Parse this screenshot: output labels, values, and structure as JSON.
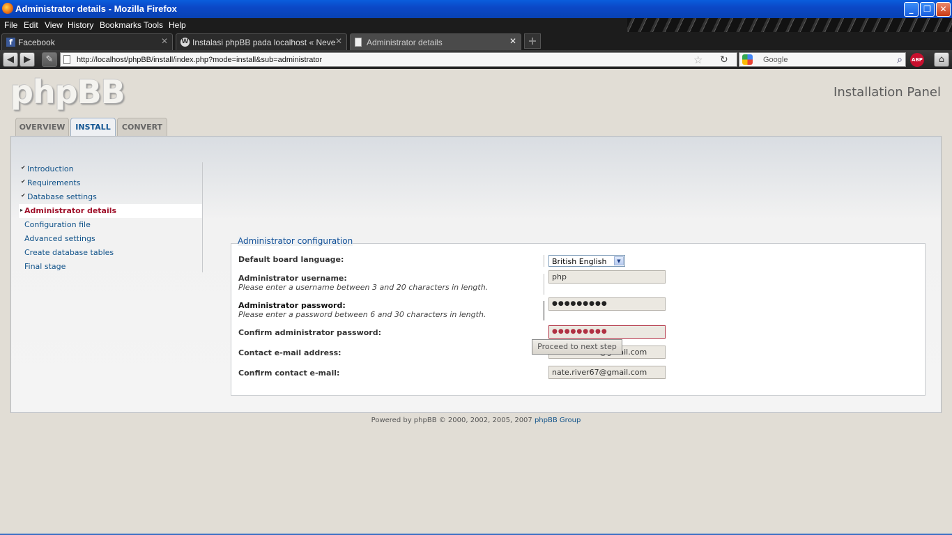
{
  "window": {
    "title": "Administrator details - Mozilla Firefox",
    "minimize": "_",
    "restore": "❐",
    "close": "✕"
  },
  "menu": [
    "File",
    "Edit",
    "View",
    "History",
    "Bookmarks",
    "Tools",
    "Help"
  ],
  "browser_tabs": [
    {
      "label": "Facebook",
      "icon": "facebook-icon"
    },
    {
      "label": "Instalasi phpBB pada localhost « Never E...",
      "icon": "wordpress-icon"
    },
    {
      "label": "Administrator details",
      "icon": "page-icon"
    }
  ],
  "new_tab": "+",
  "address": {
    "url": "http://localhost/phpBB/install/index.php?mode=install&sub=administrator"
  },
  "search": {
    "placeholder": "Google"
  },
  "abp": "ABP",
  "site": {
    "logo": "phpBB",
    "panel_title": "Installation Panel"
  },
  "page_tabs": [
    "OVERVIEW",
    "INSTALL",
    "CONVERT"
  ],
  "sidebar": {
    "items": [
      {
        "label": "Introduction",
        "state": "done"
      },
      {
        "label": "Requirements",
        "state": "done"
      },
      {
        "label": "Database settings",
        "state": "done"
      },
      {
        "label": "Administrator details",
        "state": "active"
      },
      {
        "label": "Configuration file",
        "state": "todo"
      },
      {
        "label": "Advanced settings",
        "state": "todo"
      },
      {
        "label": "Create database tables",
        "state": "todo"
      },
      {
        "label": "Final stage",
        "state": "todo"
      }
    ]
  },
  "form": {
    "legend": "Administrator configuration",
    "language_label": "Default board language:",
    "language_value": "British English",
    "username_label": "Administrator username:",
    "username_hint": "Please enter a username between 3 and 20 characters in length.",
    "username_value": "php",
    "password_label": "Administrator password:",
    "password_hint": "Please enter a password between 6 and 30 characters in length.",
    "password_value": "●●●●●●●●●",
    "confirm_password_label": "Confirm administrator password:",
    "confirm_password_value": "●●●●●●●●●",
    "email_label": "Contact e-mail address:",
    "email_value": "nate.river67@gmail.com",
    "confirm_email_label": "Confirm contact e-mail:",
    "confirm_email_value": "nate.river67@gmail.com",
    "submit": "Proceed to next step"
  },
  "footer": {
    "text": "Powered by phpBB © 2000, 2002, 2005, 2007 ",
    "link": "phpBB Group"
  },
  "colors": {
    "link": "#105289",
    "active_nav": "#a0122b",
    "error": "#b03042",
    "titlebar": "#0b48c7"
  }
}
